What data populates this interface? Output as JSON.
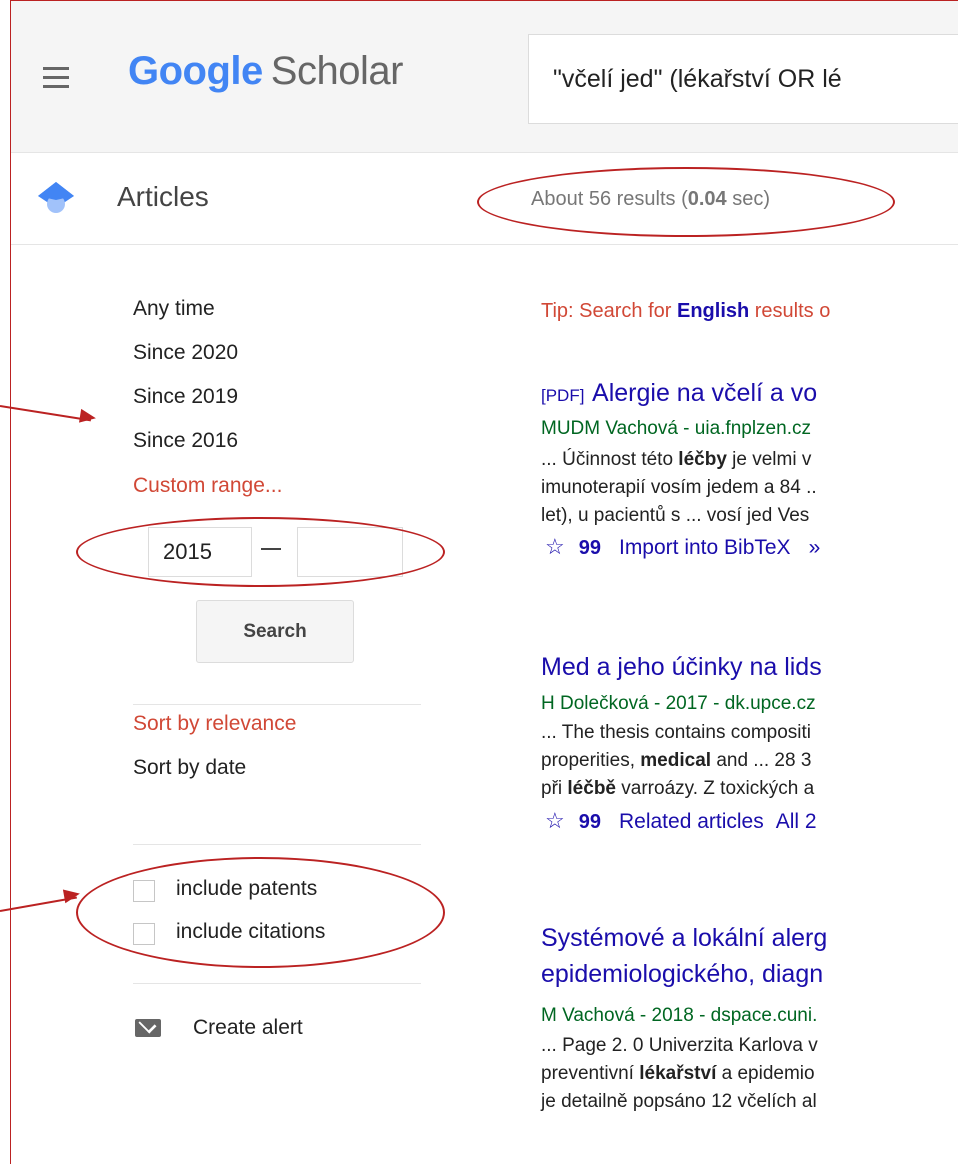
{
  "header": {
    "logo_google": "Google",
    "logo_scholar": "Scholar",
    "query": "\"včelí jed\" (lékařství OR lé"
  },
  "articles_row": {
    "label": "Articles",
    "results_prefix": "About 56 results (",
    "results_time": "0.04",
    "results_suffix": " sec)"
  },
  "sidebar": {
    "time_filters": [
      "Any time",
      "Since 2020",
      "Since 2019",
      "Since 2016"
    ],
    "custom_range_label": "Custom range...",
    "range_from": "2015",
    "range_to": "",
    "search_button": "Search",
    "sort_relevance": "Sort by relevance",
    "sort_date": "Sort by date",
    "include_patents": "include patents",
    "include_citations": "include citations",
    "create_alert": "Create alert"
  },
  "tip": {
    "prefix": "Tip: Search for ",
    "bold": "English",
    "suffix": " results o"
  },
  "results": [
    {
      "pdf_tag": "[PDF]",
      "title": "Alergie na včelí a vo",
      "meta": "MUDM Vachová - uia.fnplzen.cz",
      "snippet": [
        "... Účinnost této léčby je velmi v",
        "imunoterapií vosím jedem a 84 ..",
        "let), u pacientů s ... vosí jed Ves"
      ],
      "actions": [
        "Import into BibTeX",
        "»"
      ]
    },
    {
      "title": "Med a jeho účinky na lids",
      "meta": "H Dolečková - 2017 - dk.upce.cz",
      "snippet": [
        "... The thesis contains compositi",
        "properities, medical and ... 28 3",
        "při léčbě varroázy. Z toxických a"
      ],
      "actions": [
        "Related articles",
        "All 2"
      ]
    },
    {
      "title_line1": "Systémové a lokální alerg",
      "title_line2": "epidemiologického, diagn",
      "meta": "M Vachová - 2018 - dspace.cuni.",
      "snippet": [
        "... Page 2. 0 Univerzita Karlova v",
        "preventivní lékařství a epidemio",
        "je detailně popsáno 12 včelích al"
      ]
    }
  ],
  "colors": {
    "annotation": "#bb2222",
    "link": "#1a0dab",
    "meta_green": "#006621",
    "accent_red": "#d14836"
  }
}
